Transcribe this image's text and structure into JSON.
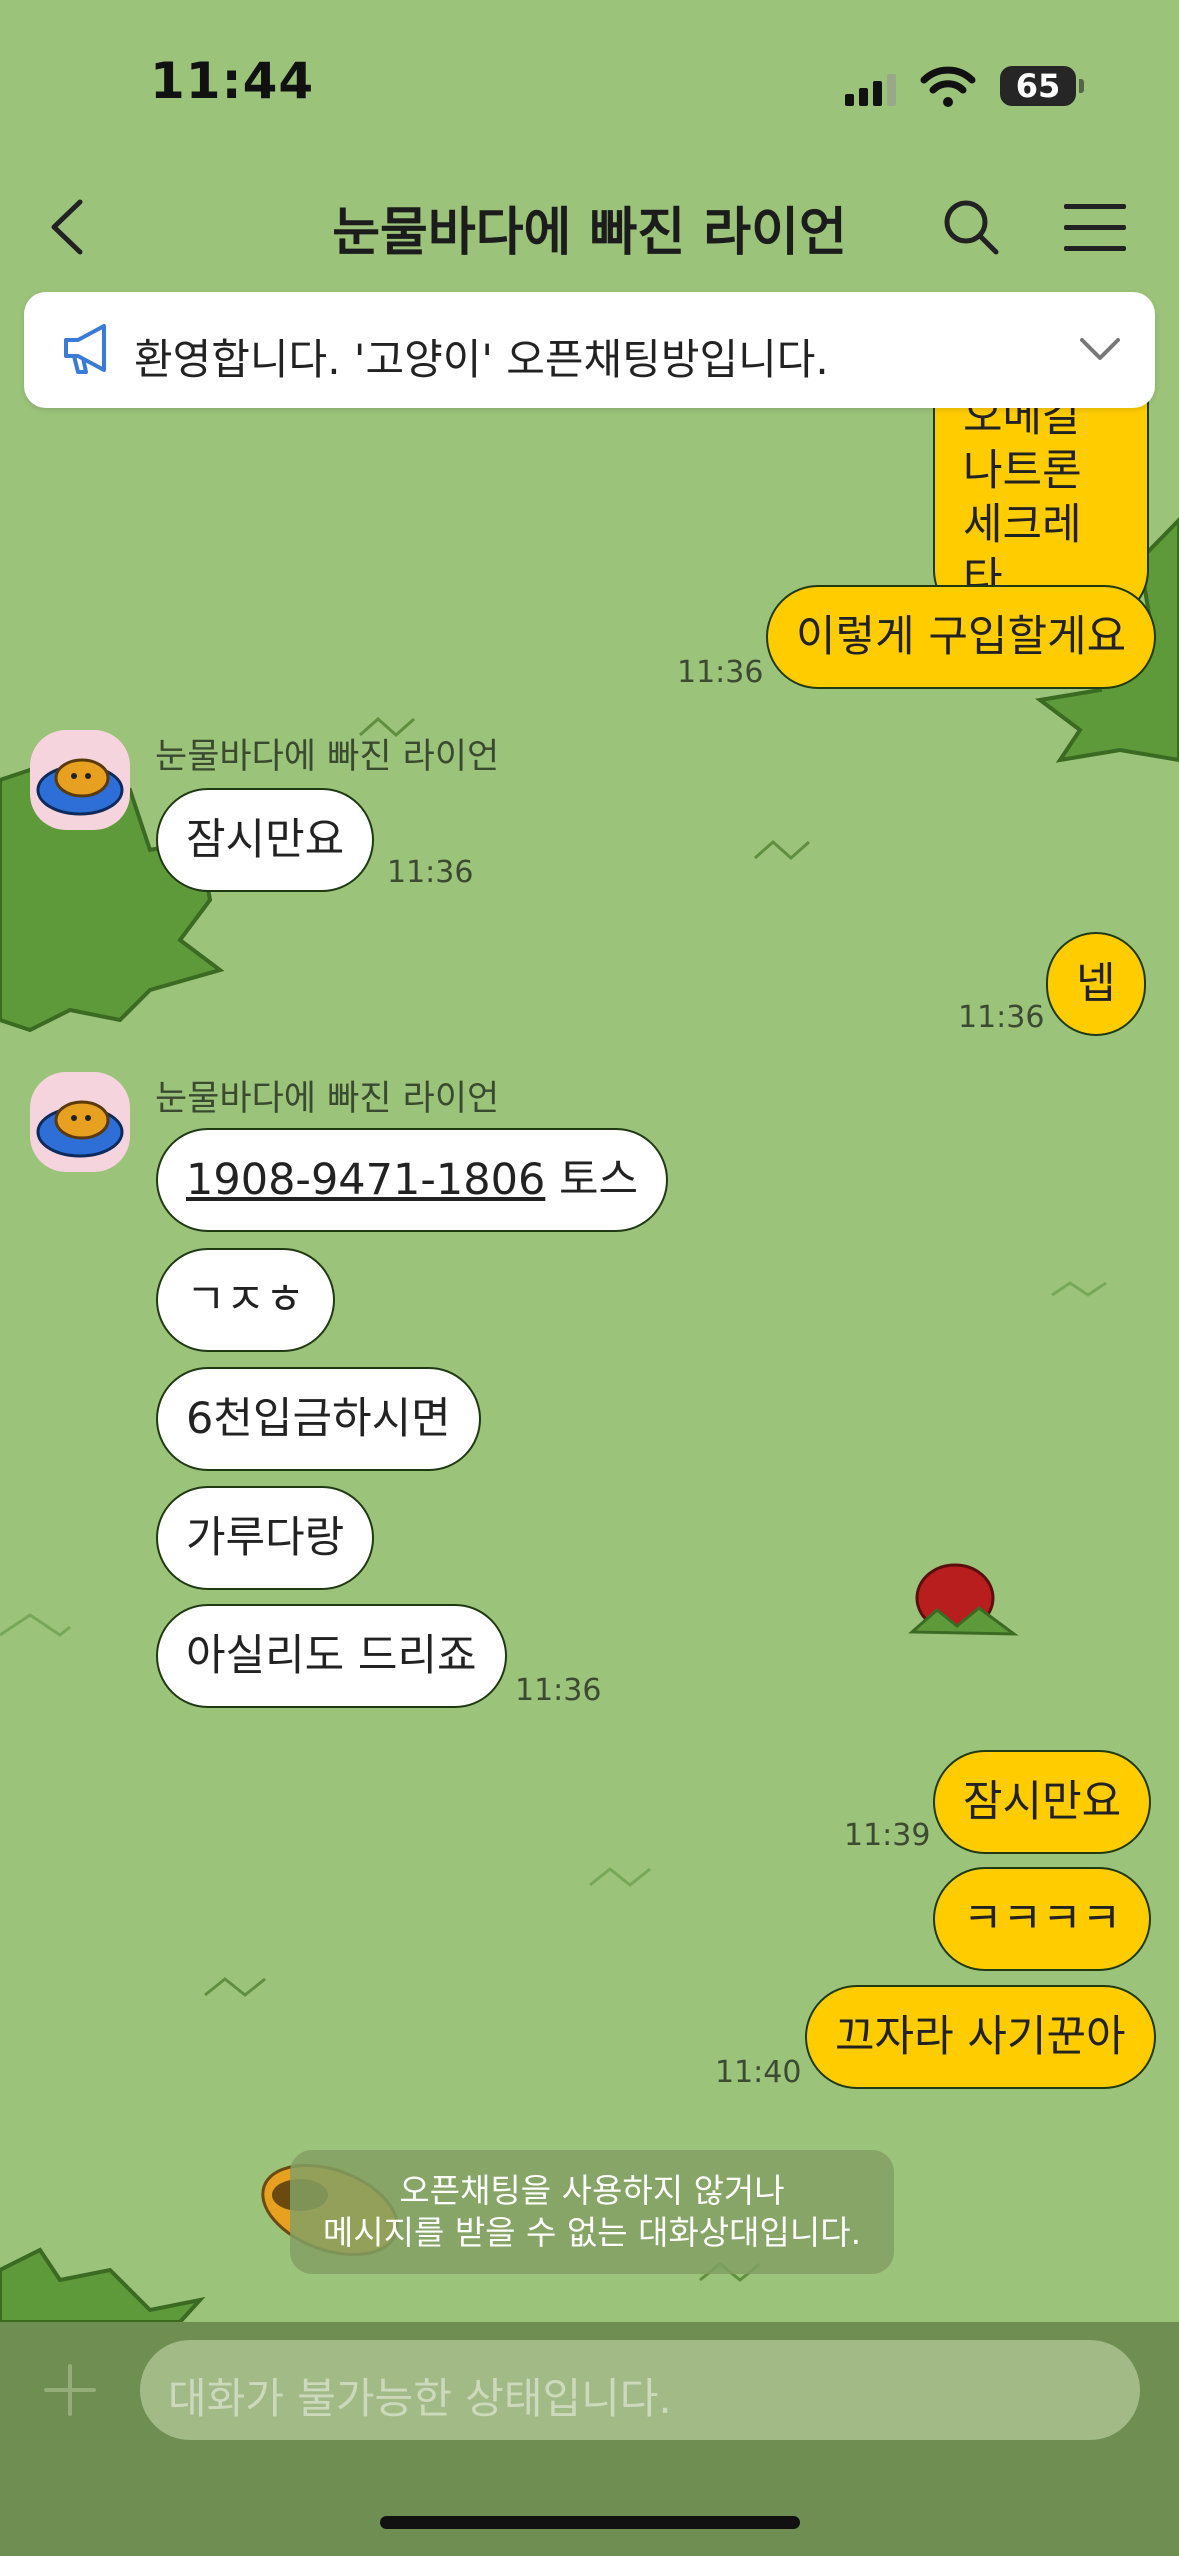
{
  "status_bar": {
    "time": "11:44",
    "battery": "65"
  },
  "header": {
    "title": "눈물바다에 빠진 라이언"
  },
  "notice": {
    "text": "환영합니다. '고양이' 오픈채팅방입니다."
  },
  "messages": {
    "m0": {
      "lines": [
        "오메갈",
        "나트론",
        "세크레타"
      ]
    },
    "m1": {
      "text": "이렇게 구입할게요",
      "time": "11:36"
    },
    "g1": {
      "sender": "눈물바다에 빠진 라이언",
      "text": "잠시만요",
      "time": "11:36"
    },
    "m2": {
      "text": "넵",
      "time": "11:36"
    },
    "g2": {
      "sender": "눈물바다에 빠진 라이언",
      "account": "1908-9471-1806",
      "bank": "토스",
      "b2": "ㄱㅈㅎ",
      "b3": "6천입금하시면",
      "b4": "가루다랑",
      "b5": "아실리도 드리죠",
      "time": "11:36"
    },
    "m3": {
      "text": "잠시만요",
      "time": "11:39"
    },
    "m4": {
      "text": "ㅋㅋㅋㅋ"
    },
    "m5": {
      "text": "끄자라 사기꾼아",
      "time": "11:40"
    }
  },
  "system_notice": {
    "line1": "오픈채팅을 사용하지 않거나",
    "line2": "메시지를 받을 수 없는 대화상대입니다."
  },
  "input": {
    "placeholder": "대화가 불가능한 상태입니다."
  },
  "icons": [
    "signal-icon",
    "wifi-icon",
    "battery-icon",
    "back-icon",
    "search-icon",
    "menu-icon",
    "megaphone-icon",
    "chevron-down-icon",
    "plus-icon",
    "avatar-icon"
  ],
  "colors": {
    "background": "#9cc37a",
    "my_bubble": "#ffcc00",
    "their_bubble": "#ffffff",
    "input_bar": "#6f8f52"
  }
}
